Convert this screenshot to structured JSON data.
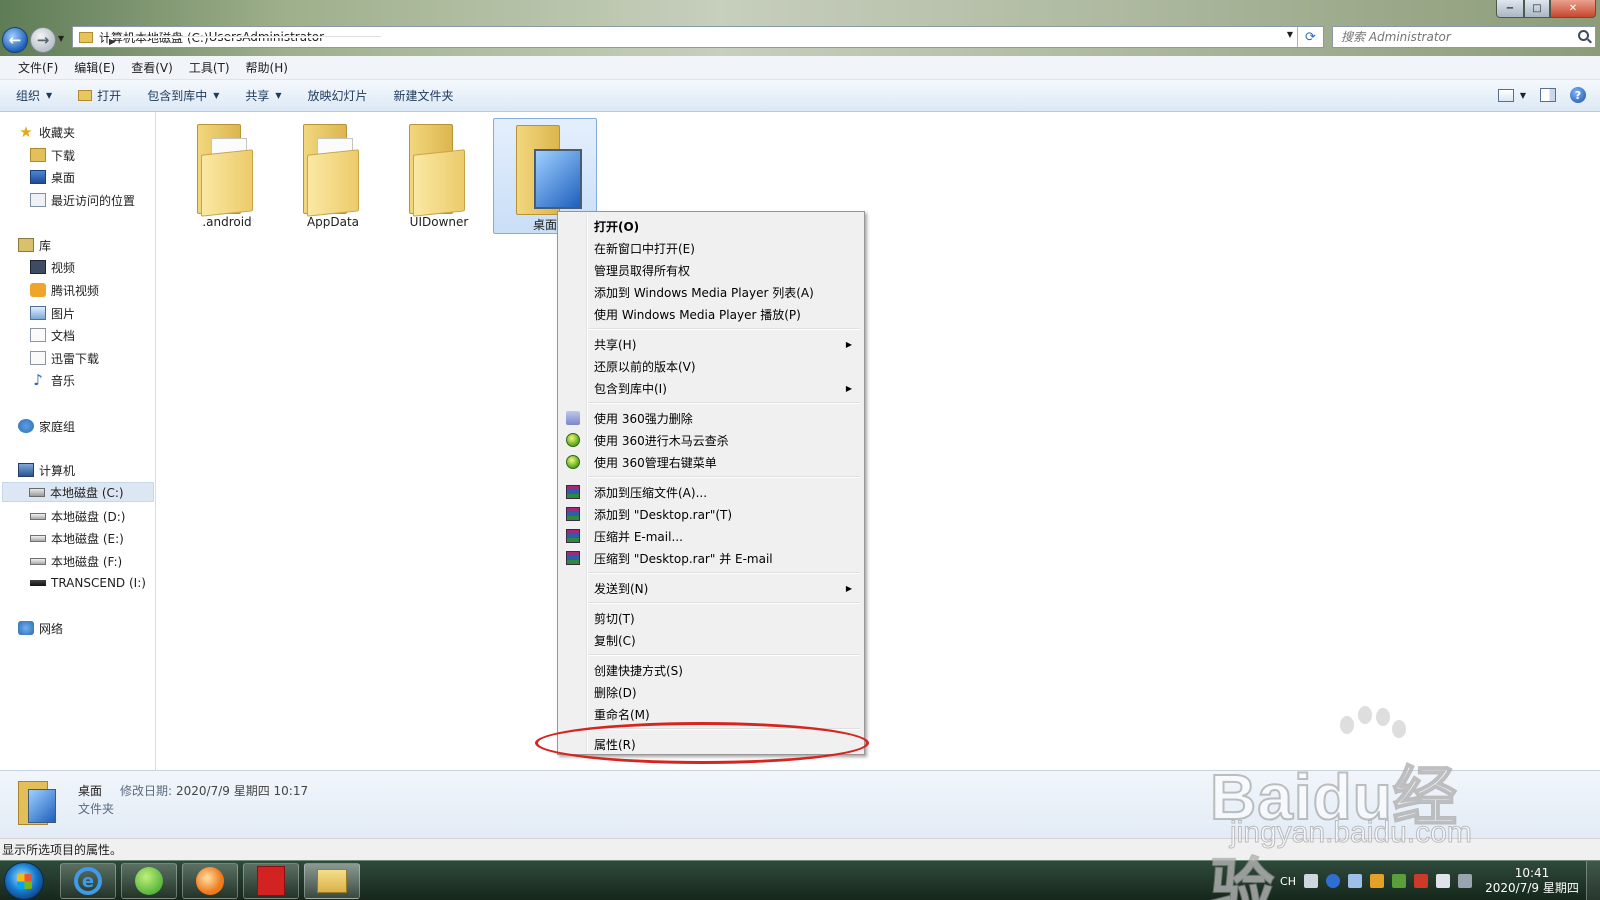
{
  "window": {
    "controls": {
      "minimize": "−",
      "maximize": "□",
      "close": "✕"
    }
  },
  "nav": {
    "back": "←",
    "forward": "→"
  },
  "address": {
    "crumbs": [
      "计算机",
      "本地磁盘 (C:)",
      "Users",
      "Administrator"
    ]
  },
  "search": {
    "placeholder": "搜索 Administrator"
  },
  "menubar": [
    "文件(F)",
    "编辑(E)",
    "查看(V)",
    "工具(T)",
    "帮助(H)"
  ],
  "toolbar": {
    "organize": "组织",
    "open": "打开",
    "include": "包含到库中",
    "share": "共享",
    "slideshow": "放映幻灯片",
    "new_folder": "新建文件夹"
  },
  "navpane": {
    "favorites": "收藏夹",
    "downloads": "下载",
    "desktop": "桌面",
    "recent": "最近访问的位置",
    "libraries": "库",
    "video": "视频",
    "tencent_video": "腾讯视频",
    "pictures": "图片",
    "documents": "文档",
    "xunlei": "迅雷下载",
    "music": "音乐",
    "homegroup": "家庭组",
    "computer": "计算机",
    "drive_c": "本地磁盘 (C:)",
    "drive_d": "本地磁盘 (D:)",
    "drive_e": "本地磁盘 (E:)",
    "drive_f": "本地磁盘 (F:)",
    "drive_i": "TRANSCEND (I:)",
    "network": "网络"
  },
  "files": [
    ".android",
    "AppData",
    "UIDowner",
    "桌面"
  ],
  "context_menu": {
    "open": "打开(O)",
    "open_new_window": "在新窗口中打开(E)",
    "take_ownership": "管理员取得所有权",
    "wmp_add": "添加到 Windows Media Player 列表(A)",
    "wmp_play": "使用 Windows Media Player 播放(P)",
    "share": "共享(H)",
    "restore_versions": "还原以前的版本(V)",
    "include_library": "包含到库中(I)",
    "del_360": "使用 360强力删除",
    "scan_360": "使用 360进行木马云查杀",
    "manage_360": "使用 360管理右键菜单",
    "add_archive": "添加到压缩文件(A)...",
    "add_rar": "添加到 \"Desktop.rar\"(T)",
    "compress_email": "压缩并 E-mail...",
    "compress_rar_email": "压缩到 \"Desktop.rar\" 并 E-mail",
    "send_to": "发送到(N)",
    "cut": "剪切(T)",
    "copy": "复制(C)",
    "create_shortcut": "创建快捷方式(S)",
    "delete": "删除(D)",
    "rename": "重命名(M)",
    "properties": "属性(R)"
  },
  "details": {
    "name": "桌面",
    "modified_label": "修改日期:",
    "modified_value": "2020/7/9 星期四 10:17",
    "type": "文件夹"
  },
  "statusbar": {
    "text": "显示所选项目的属性。"
  },
  "taskbar": {
    "ie_glyph": "e",
    "tray_lang": "CH",
    "clock_time": "10:41",
    "clock_date": "2020/7/9 星期四"
  },
  "watermark": {
    "brand": "Baidu经验",
    "url": "jingyan.baidu.com"
  },
  "colors": {
    "highlight_ellipse": "#d6241f",
    "selection": "#c9def7"
  }
}
